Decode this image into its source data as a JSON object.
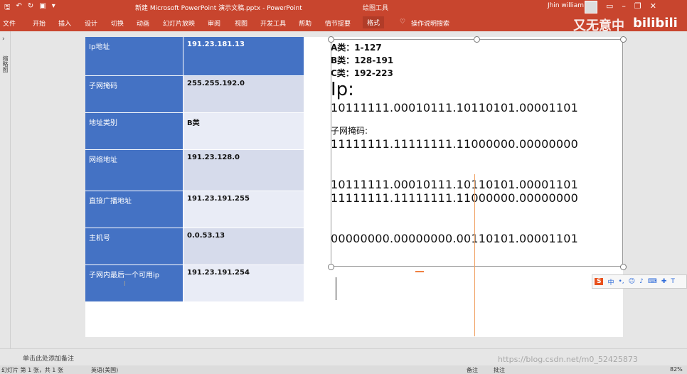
{
  "titlebar": {
    "doc_title": "新建 Microsoft PowerPoint 演示文稿.pptx  -  PowerPoint",
    "context_tools": "绘图工具",
    "user_name": "Jhin william",
    "colors": {
      "ribbon": "#c8452e"
    }
  },
  "ribbon": {
    "tabs": [
      "文件",
      "开始",
      "插入",
      "设计",
      "切换",
      "动画",
      "幻灯片放映",
      "审阅",
      "视图",
      "开发工具",
      "帮助",
      "情节提要",
      "格式"
    ],
    "tell_me": "操作说明搜索",
    "brand": "又无意中",
    "brand2": "bilibili"
  },
  "leftstrip": {
    "label": "缩略图"
  },
  "table": {
    "rows": [
      {
        "key": "Ip地址",
        "value": "191.23.181.13"
      },
      {
        "key": "子网掩码",
        "value": "255.255.192.0"
      },
      {
        "key": "地址类别",
        "value": "B类"
      },
      {
        "key": "网络地址",
        "value": "191.23.128.0"
      },
      {
        "key": "直接广播地址",
        "value": "191.23.191.255"
      },
      {
        "key": "主机号",
        "value": "0.0.53.13"
      },
      {
        "key": "子网内最后一个可用ip",
        "value": "191.23.191.254"
      }
    ]
  },
  "notes_text": {
    "class_a": "A类：1-127",
    "class_b": "B类：128-191",
    "class_c": "C类：192-223",
    "ip_label": "Ip:",
    "ip_bin": "10111111.00010111.10110101.00001101",
    "mask_label": "子网掩码:",
    "mask_bin": "11111111.11111111.11000000.00000000",
    "and_ip": "10111111.00010111.10110101.00001101",
    "and_mask": "11111111.11111111.11000000.00000000",
    "host_bin": "00000000.00000000.00110101.00001101"
  },
  "ime": {
    "lang": "中"
  },
  "notes_pane": {
    "placeholder": "单击此处添加备注"
  },
  "status": {
    "slide_info": "幻灯片 第 1 张，共 1 张",
    "language": "英语(美国)",
    "notes_btn": "备注",
    "comments_btn": "批注",
    "zoom": "82%"
  },
  "watermark": "https://blog.csdn.net/m0_52425873"
}
